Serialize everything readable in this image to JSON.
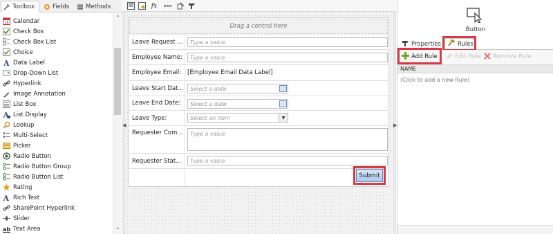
{
  "toolbox": {
    "tabs": [
      {
        "label": "Toolbox",
        "icon": "wrench-icon"
      },
      {
        "label": "Fields",
        "icon": "fields-icon"
      },
      {
        "label": "Methods",
        "icon": "methods-icon"
      }
    ],
    "items": [
      {
        "label": "Calendar",
        "icon": "calendar-icon"
      },
      {
        "label": "Check Box",
        "icon": "check-box-icon"
      },
      {
        "label": "Check Box List",
        "icon": "check-box-list-icon"
      },
      {
        "label": "Choice",
        "icon": "choice-icon"
      },
      {
        "label": "Data Label",
        "icon": "data-label-icon"
      },
      {
        "label": "Drop-Down List",
        "icon": "drop-down-list-icon"
      },
      {
        "label": "Hyperlink",
        "icon": "hyperlink-icon"
      },
      {
        "label": "Image Annotation",
        "icon": "image-annotation-icon"
      },
      {
        "label": "List Box",
        "icon": "list-box-icon"
      },
      {
        "label": "List Display",
        "icon": "list-display-icon"
      },
      {
        "label": "Lookup",
        "icon": "lookup-icon"
      },
      {
        "label": "Multi-Select",
        "icon": "multi-select-icon"
      },
      {
        "label": "Picker",
        "icon": "picker-icon"
      },
      {
        "label": "Radio Button",
        "icon": "radio-button-icon"
      },
      {
        "label": "Radio Button Group",
        "icon": "radio-button-group-icon"
      },
      {
        "label": "Radio Button List",
        "icon": "radio-button-list-icon"
      },
      {
        "label": "Rating",
        "icon": "rating-icon"
      },
      {
        "label": "Rich Text",
        "icon": "rich-text-icon"
      },
      {
        "label": "SharePoint Hyperlink",
        "icon": "sharepoint-hyperlink-icon"
      },
      {
        "label": "Slider",
        "icon": "slider-icon"
      },
      {
        "label": "Text Area",
        "icon": "text-area-icon"
      }
    ]
  },
  "form": {
    "drag_hint": "Drag a control here",
    "rows": [
      {
        "label": "Leave Request ...",
        "type": "text",
        "placeholder": "Type a value"
      },
      {
        "label": "Employee Name:",
        "type": "text",
        "placeholder": "Type a value"
      },
      {
        "label": "Employee Email:",
        "type": "static",
        "value": "[Employee Email Data Label]"
      },
      {
        "label": "Leave Start Dat...",
        "type": "date",
        "placeholder": "Select a date"
      },
      {
        "label": "Leave End Date:",
        "type": "date",
        "placeholder": "Select a date"
      },
      {
        "label": "Leave Type:",
        "type": "select",
        "placeholder": "Select an item"
      },
      {
        "label": "Requester Com...",
        "type": "textarea",
        "placeholder": "Type a value"
      },
      {
        "label": "Requester Stat...",
        "type": "text",
        "placeholder": "Type a value"
      }
    ],
    "submit_label": "Submit"
  },
  "properties_panel": {
    "selected_control": "Button",
    "tabs": [
      "Properties",
      "Rules"
    ],
    "toolbar": {
      "add_rule": "Add Rule",
      "edit_rule": "Edit Rule",
      "remove_rule": "Remove Rule"
    },
    "column_header": "NAME",
    "empty_text": "(Click to add a new Rule)"
  },
  "colors": {
    "highlight": "#d63a45",
    "add_icon": "#6ea51a",
    "remove_icon": "#e07070"
  }
}
